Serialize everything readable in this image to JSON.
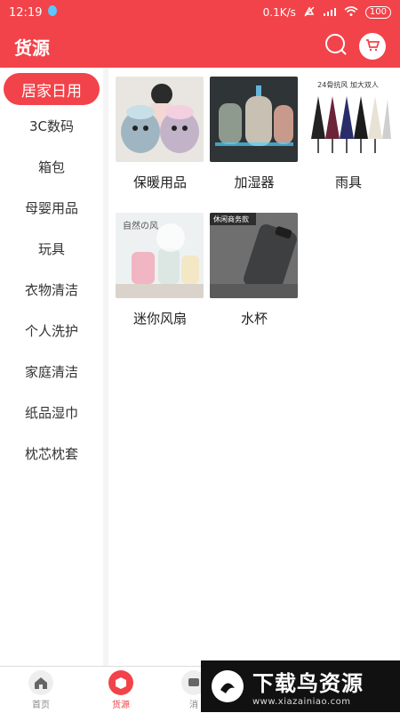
{
  "status": {
    "time": "12:19",
    "speed": "0.1K/s",
    "battery": "100"
  },
  "header": {
    "title": "货源"
  },
  "sidebar": {
    "items": [
      {
        "label": "居家日用",
        "active": true
      },
      {
        "label": "3C数码"
      },
      {
        "label": "箱包"
      },
      {
        "label": "母婴用品"
      },
      {
        "label": "玩具"
      },
      {
        "label": "衣物清洁"
      },
      {
        "label": "个人洗护"
      },
      {
        "label": "家庭清洁"
      },
      {
        "label": "纸品湿巾"
      },
      {
        "label": "枕芯枕套"
      }
    ]
  },
  "products": [
    {
      "label": "保暖用品"
    },
    {
      "label": "加湿器"
    },
    {
      "label": "雨具",
      "image_text": "24骨抗风 加大双人"
    },
    {
      "label": "迷你风扇",
      "image_text": "自然の风"
    },
    {
      "label": "水杯",
      "image_text": "休闲商务款"
    }
  ],
  "tabs": [
    {
      "label": "首页"
    },
    {
      "label": "货源",
      "active": true
    },
    {
      "label": "消"
    }
  ],
  "watermark": {
    "big": "下载鸟资源",
    "small": "www.xiazainiao.com"
  },
  "colors": {
    "brand_red": "#f2434a",
    "sidebar_bg": "#ffffff",
    "divider": "#f5f5f5"
  }
}
